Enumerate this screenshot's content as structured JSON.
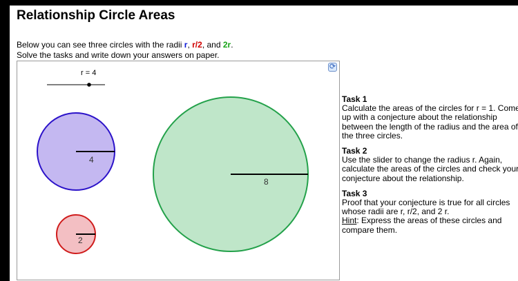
{
  "title": "Relationship Circle Areas",
  "intro": {
    "line1_prefix": "Below you can see three circles with the radii ",
    "r1": "r",
    "sep1": ", ",
    "r2": "r/2",
    "sep2": ", and ",
    "r3": "2r",
    "end": ".",
    "line2": "Solve the tasks and write down your answers on paper."
  },
  "applet": {
    "slider_label": "r = 4",
    "slider_value": 4,
    "circles": [
      {
        "name": "blue",
        "label": "4",
        "fill": "#c4b8f1",
        "stroke": "#2b12c9"
      },
      {
        "name": "red",
        "label": "2",
        "fill": "#f3bfc3",
        "stroke": "#cf1b1b"
      },
      {
        "name": "green",
        "label": "8",
        "fill": "#bfe6c9",
        "stroke": "#23a14a"
      }
    ],
    "refresh_icon": "refresh-icon"
  },
  "tasks": [
    {
      "title": "Task 1",
      "text": "Calculate the areas of the circles for r = 1. Come up with a conjecture about the relationship between the length of the radius and the area of the three circles."
    },
    {
      "title": "Task 2",
      "text": "Use the slider to change the radius r. Again, calculate the areas of the circles and check your conjecture about the relationship."
    },
    {
      "title": "Task 3",
      "text": "Proof that your conjecture is true for all circles whose radii are r, r/2, and 2 r.",
      "hint_label": "Hint",
      "hint_text": ": Express the areas of these circles and compare them."
    }
  ]
}
